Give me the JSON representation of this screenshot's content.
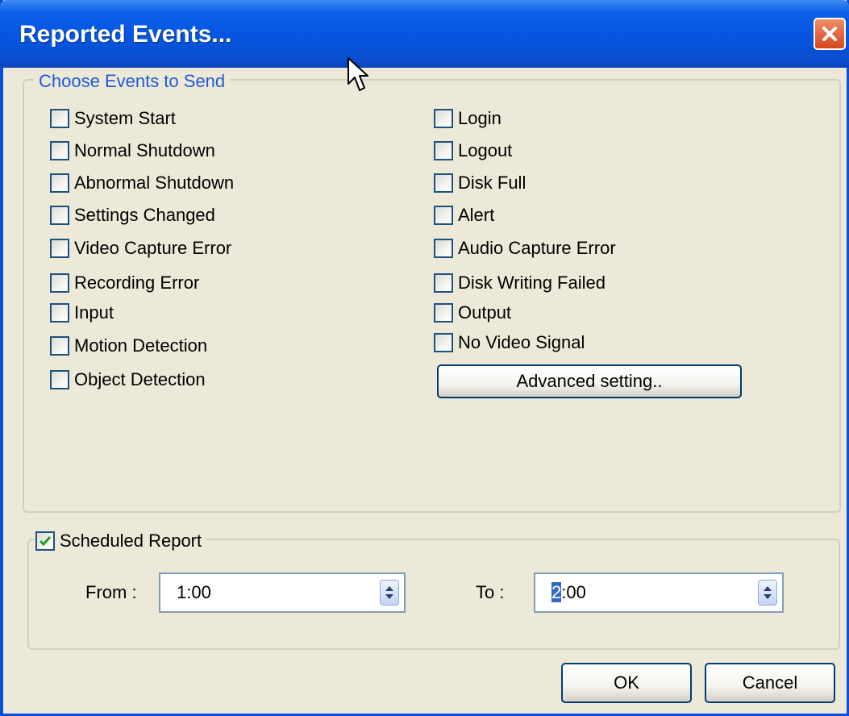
{
  "window": {
    "title": "Reported Events..."
  },
  "events_group": {
    "legend": "Choose Events to Send",
    "left_items": [
      {
        "label": "System Start",
        "checked": false
      },
      {
        "label": "Normal Shutdown",
        "checked": false
      },
      {
        "label": "Abnormal Shutdown",
        "checked": false
      },
      {
        "label": "Settings Changed",
        "checked": false
      },
      {
        "label": "Video Capture Error",
        "checked": false
      },
      {
        "label": "Recording Error",
        "checked": false
      },
      {
        "label": "Input",
        "checked": false
      },
      {
        "label": "Motion Detection",
        "checked": false
      },
      {
        "label": "Object Detection",
        "checked": false
      }
    ],
    "right_items": [
      {
        "label": "Login",
        "checked": false
      },
      {
        "label": "Logout",
        "checked": false
      },
      {
        "label": "Disk Full",
        "checked": false
      },
      {
        "label": "Alert",
        "checked": false
      },
      {
        "label": "Audio Capture Error",
        "checked": false
      },
      {
        "label": "Disk Writing Failed",
        "checked": false
      },
      {
        "label": "Output",
        "checked": false
      },
      {
        "label": "No Video Signal",
        "checked": false
      }
    ],
    "advanced_button": "Advanced setting.."
  },
  "schedule": {
    "label": "Scheduled Report",
    "checked": true,
    "from_label": "From :",
    "from_value": "1:00",
    "to_label": "To :",
    "to_value_selected": "2",
    "to_value_rest": ":00"
  },
  "buttons": {
    "ok": "OK",
    "cancel": "Cancel"
  },
  "icons": {
    "close": "close-icon",
    "checkmark": "checkmark-icon",
    "spin": "spin-arrows-icon",
    "cursor": "mouse-pointer-icon"
  }
}
